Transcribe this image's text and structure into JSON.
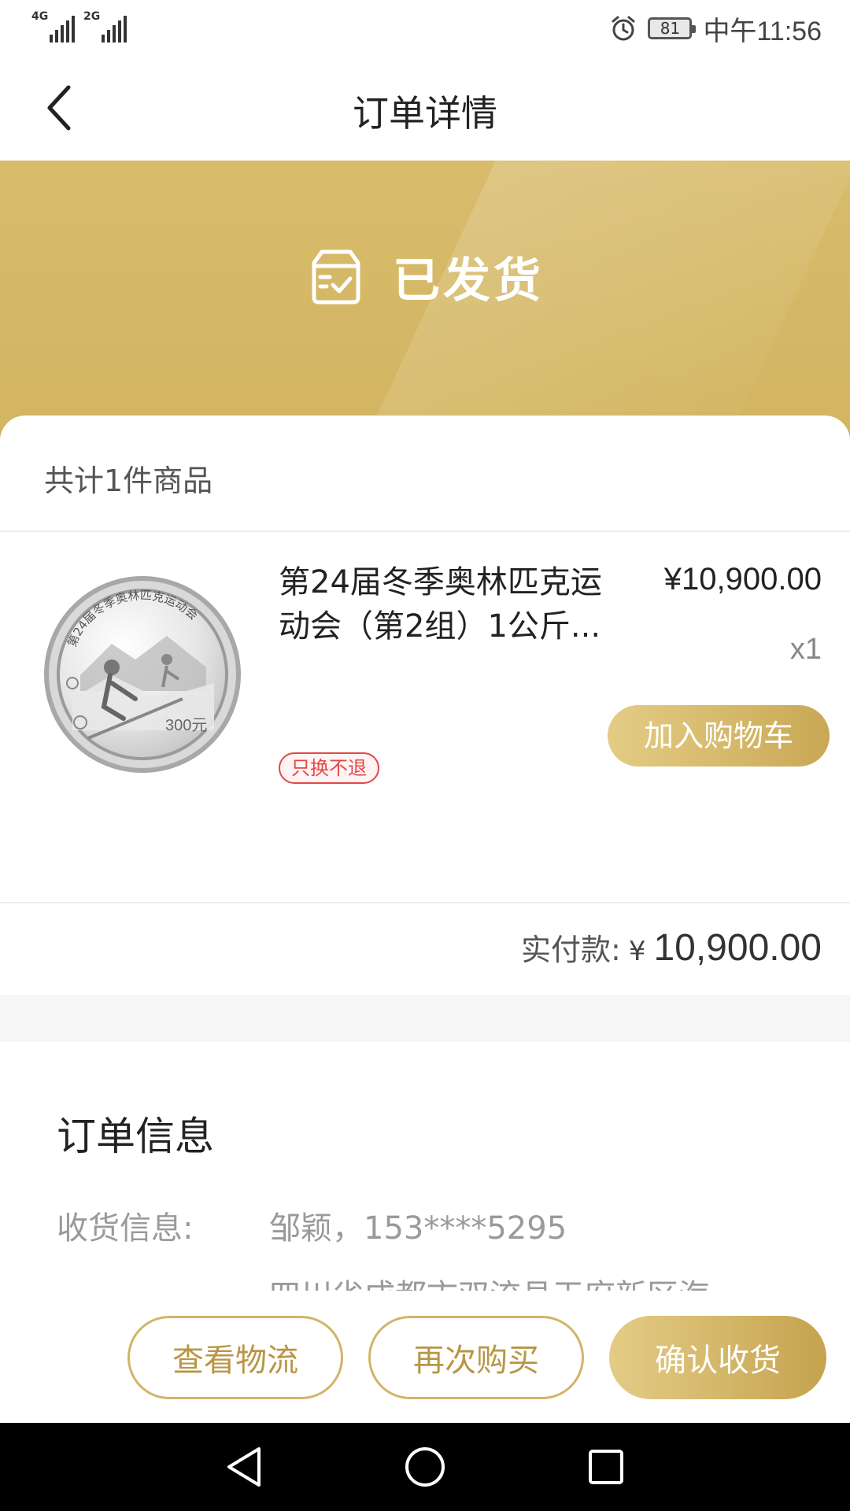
{
  "status_bar": {
    "network1": "4G",
    "network2": "2G",
    "battery": "81",
    "time": "中午11:56"
  },
  "header": {
    "title": "订单详情"
  },
  "hero": {
    "status_label": "已发货",
    "accent_color": "#d6b965"
  },
  "summary": {
    "count_text": "共计1件商品"
  },
  "product": {
    "name": "第24届冬季奥林匹克运动会（第2组）1公斤...",
    "price": "¥10,900.00",
    "quantity": "x1",
    "tag": "只换不退",
    "coin_legend": "第24届冬季奥林匹克运动会",
    "coin_denomination": "300元",
    "add_cart_label": "加入购物车"
  },
  "payment": {
    "label": "实付款:",
    "currency": "¥",
    "amount": "10,900.00"
  },
  "order_info": {
    "title": "订单信息",
    "receiver_label": "收货信息:",
    "receiver_value": "邹颖，153****5295",
    "address_partial": "四川省成都市双流县天府新区海"
  },
  "actions": {
    "view_logistics": "查看物流",
    "buy_again": "再次购买",
    "confirm_receipt": "确认收货"
  },
  "colors": {
    "gold": "#c9a854",
    "gold_light": "#e4cc86",
    "tag_red": "#e04848"
  }
}
